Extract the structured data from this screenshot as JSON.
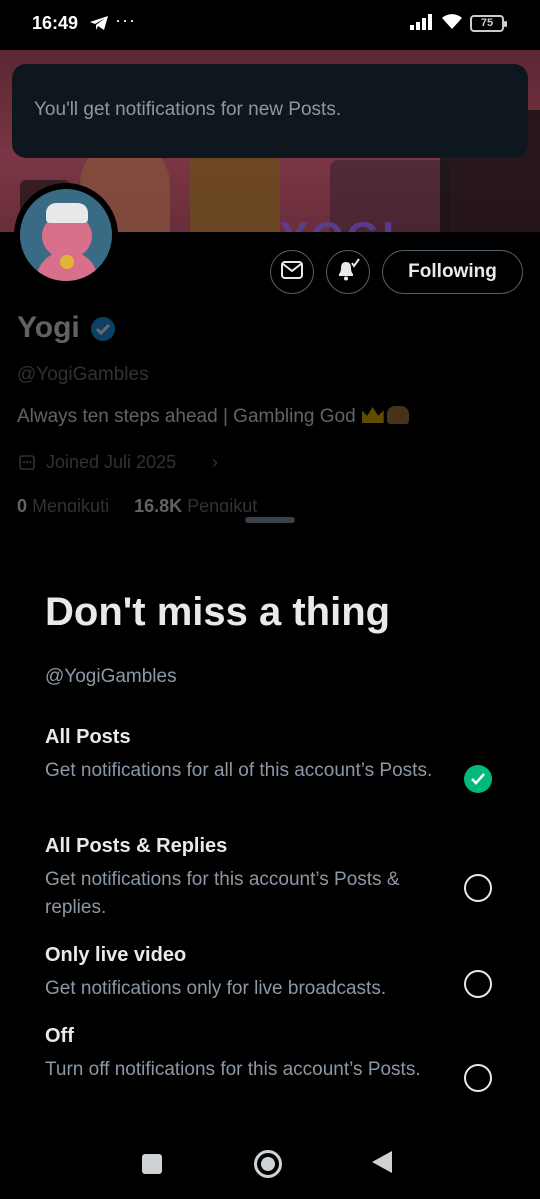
{
  "status_bar": {
    "time": "16:49",
    "menu_dots": "···",
    "battery": "75"
  },
  "toast": {
    "text": "You'll get notifications for new Posts."
  },
  "banner": {
    "word": "YOGI"
  },
  "profile": {
    "name": "Yogi",
    "handle": "@YogiGambles",
    "bio": "Always ten steps ahead | Gambling God",
    "joined": "Joined Juli 2025",
    "following_count": "0",
    "following_label": "Mengikuti",
    "followers_count": "16,8K",
    "followers_label": "Pengikut"
  },
  "actions": {
    "following_label": "Following"
  },
  "sheet": {
    "title": "Don't miss a thing",
    "handle": "@YogiGambles",
    "options": [
      {
        "title": "All Posts",
        "description": "Get notifications for all of this account’s Posts.",
        "selected": true
      },
      {
        "title": "All Posts & Replies",
        "description": "Get notifications for this account’s Posts & replies.",
        "selected": false
      },
      {
        "title": "Only live video",
        "description": "Get notifications only for live broadcasts.",
        "selected": false
      },
      {
        "title": "Off",
        "description": "Turn off notifications for this account’s Posts.",
        "selected": false
      }
    ]
  },
  "colors": {
    "accent_green": "#00ba7c",
    "verified_blue": "#1d9bf0",
    "background": "#000000"
  },
  "icons": {
    "status": [
      "telegram-icon",
      "signal-icon",
      "wifi-icon",
      "battery-icon"
    ],
    "actions": [
      "message-icon",
      "bell-icon"
    ],
    "nav": [
      "recents-icon",
      "home-icon",
      "back-icon"
    ]
  }
}
